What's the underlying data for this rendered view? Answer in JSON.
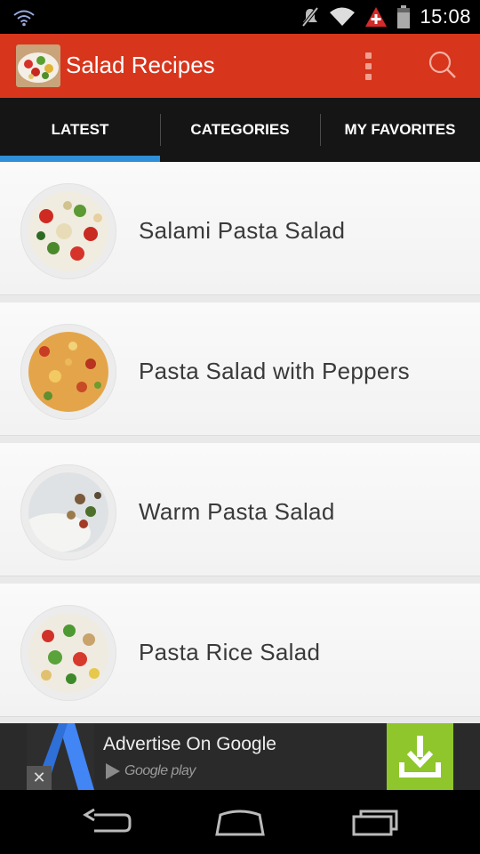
{
  "status_bar": {
    "time": "15:08",
    "icons": [
      "wifi-activity-icon",
      "mute-icon",
      "wifi-icon",
      "alert-icon",
      "battery-icon"
    ]
  },
  "app_bar": {
    "title": "Salad Recipes",
    "icons": [
      "app-logo",
      "overflow-menu-icon",
      "search-icon"
    ],
    "color": "#d7351c"
  },
  "tabs": [
    {
      "label": "LATEST",
      "active": true
    },
    {
      "label": "CATEGORIES",
      "active": false
    },
    {
      "label": "MY FAVORITES",
      "active": false
    }
  ],
  "tab_indicator_color": "#2f8fd8",
  "recipes": [
    {
      "title": "Salami Pasta Salad"
    },
    {
      "title": "Pasta Salad with Peppers"
    },
    {
      "title": "Warm Pasta Salad"
    },
    {
      "title": "Pasta Rice Salad"
    }
  ],
  "ad": {
    "title": "Advertise On Google",
    "store": "Google play",
    "icons": [
      "ad-logo",
      "close-icon",
      "play-store-icon",
      "download-icon"
    ],
    "action_color": "#8ec62b"
  },
  "nav_bar": {
    "icons": [
      "back-icon",
      "home-icon",
      "recents-icon"
    ]
  }
}
